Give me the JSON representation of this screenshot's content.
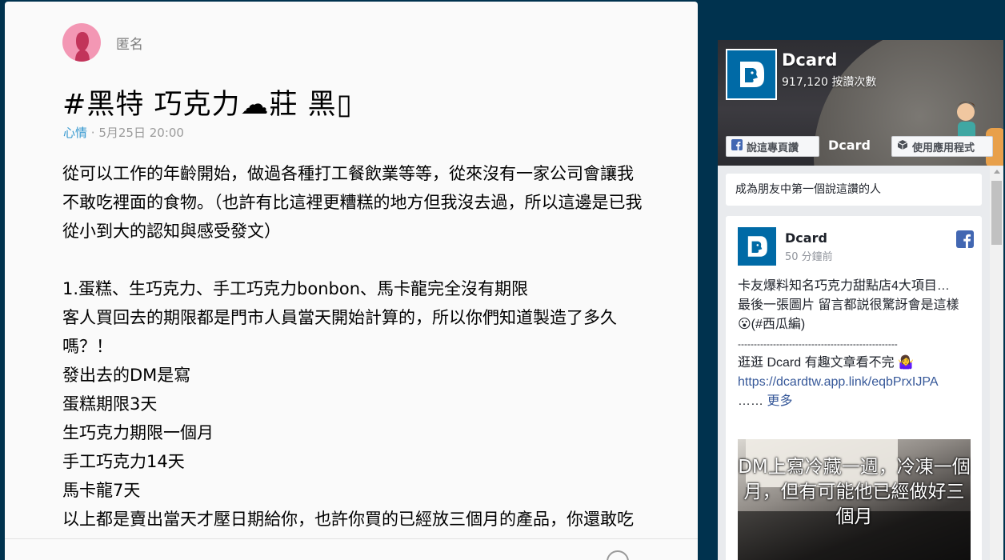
{
  "post": {
    "author": "匿名",
    "title": "#黑特 巧克力☁莊 黑▯",
    "forum": "心情",
    "date": "5月25日 20:00",
    "paragraphs": [
      "從可以工作的年齡開始，做過各種打工餐飲業等等，從來沒有一家公司會讓我不敢吃裡面的食物。（也許有比這裡更糟糕的地方但我沒去過，所以這邊是已我從小到大的認知與感受發文）",
      "",
      "1.蛋糕、生巧克力、手工巧克力bonbon、馬卡龍完全沒有期限",
      "客人買回去的期限都是門市人員當天開始計算的，所以你們知道製造了多久嗎？！",
      "發出去的DM是寫",
      "蛋糕期限3天",
      "生巧克力期限一個月",
      "手工巧克力14天",
      "馬卡龍7天",
      "以上都是賣出當天才壓日期給你，也許你買的已經放三個月的產品，你還敢吃嗎"
    ]
  },
  "fb": {
    "page_name": "Dcard",
    "likes": "917,120 按讚次數",
    "share_button": "說這專頁讚",
    "app_button": "使用應用程式",
    "cover_brand": "Dcard",
    "friends_text": "成為朋友中第一個說這讚的人",
    "post": {
      "name": "Dcard",
      "time": "50 分鐘前",
      "line1": "卡友爆料知名巧克力甜點店4大項目…",
      "line2": "最後一張圖片 留言都説很驚訝會是這樣😮(#西瓜編)",
      "divider": "--------------------------------------------------",
      "line3": "逛逛 Dcard 有趣文章看不完 🤷‍♀️",
      "link": "https://dcardtw.app.link/eqbPrxIJPA",
      "more_prefix": "…… ",
      "more": "更多",
      "image_caption": "DM上寫冷藏一週，冷凍一個月，但有可能他已經做好三個月"
    }
  },
  "colors": {
    "page_bg": "#00324e",
    "forum_link": "#3397cf",
    "fb_blue": "#4267b2",
    "dcard_blue": "#006aa6"
  }
}
